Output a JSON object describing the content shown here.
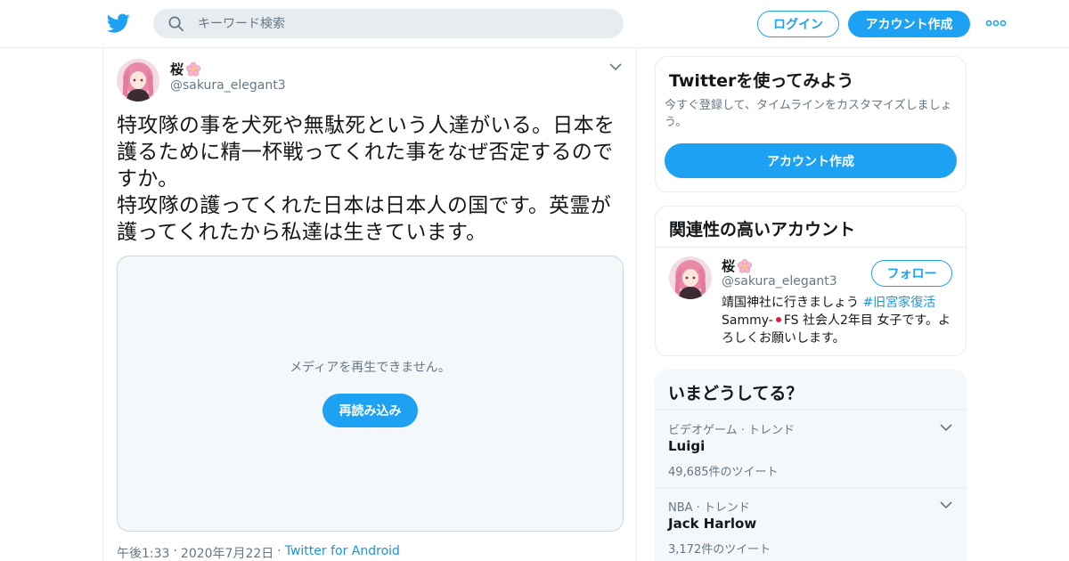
{
  "header": {
    "search_placeholder": "キーワード検索",
    "login_label": "ログイン",
    "signup_label": "アカウント作成"
  },
  "tweet": {
    "display_name": "桜",
    "handle": "@sakura_elegant3",
    "text": "特攻隊の事を犬死や無駄死という人達がいる。日本を護るために精一杯戦ってくれた事をなぜ否定するのですか。\n特攻隊の護ってくれた日本は日本人の国です。英霊が護ってくれたから私達は生きています。",
    "media": {
      "message": "メディアを再生できません。",
      "reload_label": "再読み込み"
    },
    "time": "午後1:33",
    "date": "2020年7月22日",
    "separator": "·",
    "source": "Twitter for Android"
  },
  "signup_card": {
    "title": "Twitterを使ってみよう",
    "description": "今すぐ登録して、タイムラインをカスタマイズしましょう。",
    "button_label": "アカウント作成"
  },
  "related_card": {
    "title": "関連性の高いアカウント",
    "account": {
      "display_name": "桜",
      "handle": "@sakura_elegant3",
      "follow_label": "フォロー",
      "bio_part1": "靖国神社に行きましょう ",
      "bio_hashtag": "#旧宮家復活",
      "bio_part2": "Sammy-",
      "bio_part3": "FS 社会人2年目 女子です。よろしくお願いします。"
    }
  },
  "trends_card": {
    "title": "いまどうしてる？",
    "items": [
      {
        "category": "ビデオゲーム · トレンド",
        "name": "Luigi",
        "count": "49,685件のツイート"
      },
      {
        "category": "NBA · トレンド",
        "name": "Jack Harlow",
        "count": "3,172件のツイート"
      }
    ]
  },
  "colors": {
    "brand_blue": "#1da1f2",
    "link_blue": "#1b95e0",
    "secondary_text": "#657786",
    "border": "#e6ecf0"
  },
  "icons": {
    "logo": "twitter-bird-icon",
    "search": "search-icon",
    "more": "more-dots-icon",
    "caret": "chevron-down-icon",
    "emoji": "cherry-blossom-emoji",
    "flag": "japan-flag-emoji"
  }
}
